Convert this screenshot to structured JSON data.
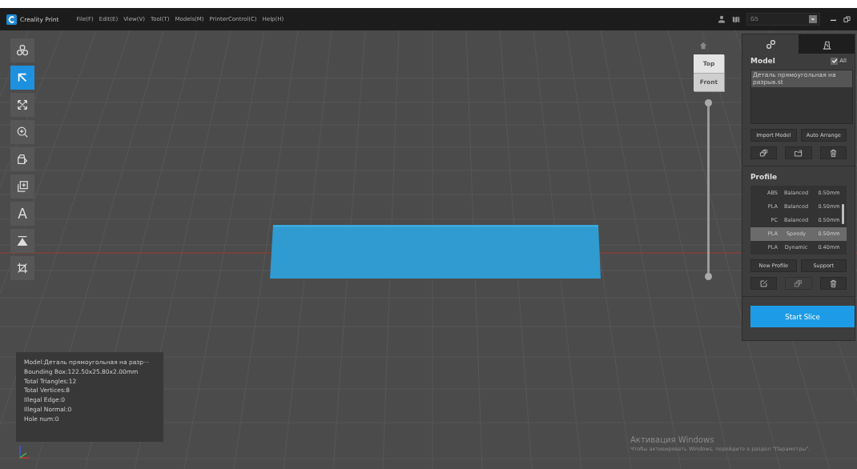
{
  "app": {
    "name": "Creality Print"
  },
  "menu": [
    "File(F)",
    "Edit(E)",
    "View(V)",
    "Tool(T)",
    "Models(M)",
    "PrinterControl(C)",
    "Help(H)"
  ],
  "printer": {
    "value": "G5"
  },
  "tools": [
    {
      "kind": "group",
      "selected": false
    },
    {
      "kind": "select",
      "selected": true
    },
    {
      "kind": "move",
      "selected": false
    },
    {
      "kind": "zoom",
      "selected": false
    },
    {
      "kind": "rotate",
      "selected": false
    },
    {
      "kind": "clone",
      "selected": false
    },
    {
      "kind": "text",
      "glyph": "A",
      "selected": false
    },
    {
      "kind": "lay-flat",
      "selected": false
    },
    {
      "kind": "cut",
      "selected": false
    }
  ],
  "view_cube": {
    "top": "Top",
    "front": "Front"
  },
  "layer_slider": {
    "level": 1
  },
  "panel": {
    "tabs": [
      {
        "kind": "settings",
        "selected": true
      },
      {
        "kind": "printer",
        "selected": false
      }
    ],
    "model": {
      "title": "Model",
      "all": {
        "label": "All",
        "checked": true
      },
      "files": [
        {
          "name": "Деталь прямоугольная на разрыв.st",
          "selected": true
        }
      ],
      "buttons": [
        "Import Model",
        "Auto Arrange"
      ],
      "icon_buttons": [
        {
          "kind": "group",
          "disabled": false
        },
        {
          "kind": "ungroup",
          "disabled": false
        },
        {
          "kind": "delete",
          "disabled": false
        }
      ]
    },
    "profile": {
      "title": "Profile",
      "rows": [
        {
          "material": "ABS",
          "quality": "Balanced",
          "layer": "0.50mm",
          "selected": false
        },
        {
          "material": "PLA",
          "quality": "Balanced",
          "layer": "0.50mm",
          "selected": false
        },
        {
          "material": "PC",
          "quality": "Balanced",
          "layer": "0.50mm",
          "selected": false
        },
        {
          "material": "PLA",
          "quality": "Speedy",
          "layer": "0.50mm",
          "selected": true
        },
        {
          "material": "PLA",
          "quality": "Dynamic",
          "layer": "0.40mm",
          "selected": false
        }
      ],
      "buttons": [
        "New Profile",
        "Support"
      ],
      "icon_buttons": [
        {
          "kind": "edit",
          "disabled": false
        },
        {
          "kind": "group",
          "disabled": true
        },
        {
          "kind": "delete",
          "disabled": false
        }
      ]
    },
    "slice": "Start Slice"
  },
  "info": [
    "Model:Деталь прямоугольная на разр···",
    "Bounding Box:122.50x25.80x2.00mm",
    "Total Triangles:12",
    "Total Vertices:8",
    "Illegal Edge:0",
    "Illegal Normal:0",
    "Hole num:0"
  ],
  "activation": {
    "title": "Активация Windows",
    "text": "Чтобы активировать Windows, перейдите в раздел \"Параметры\"."
  }
}
